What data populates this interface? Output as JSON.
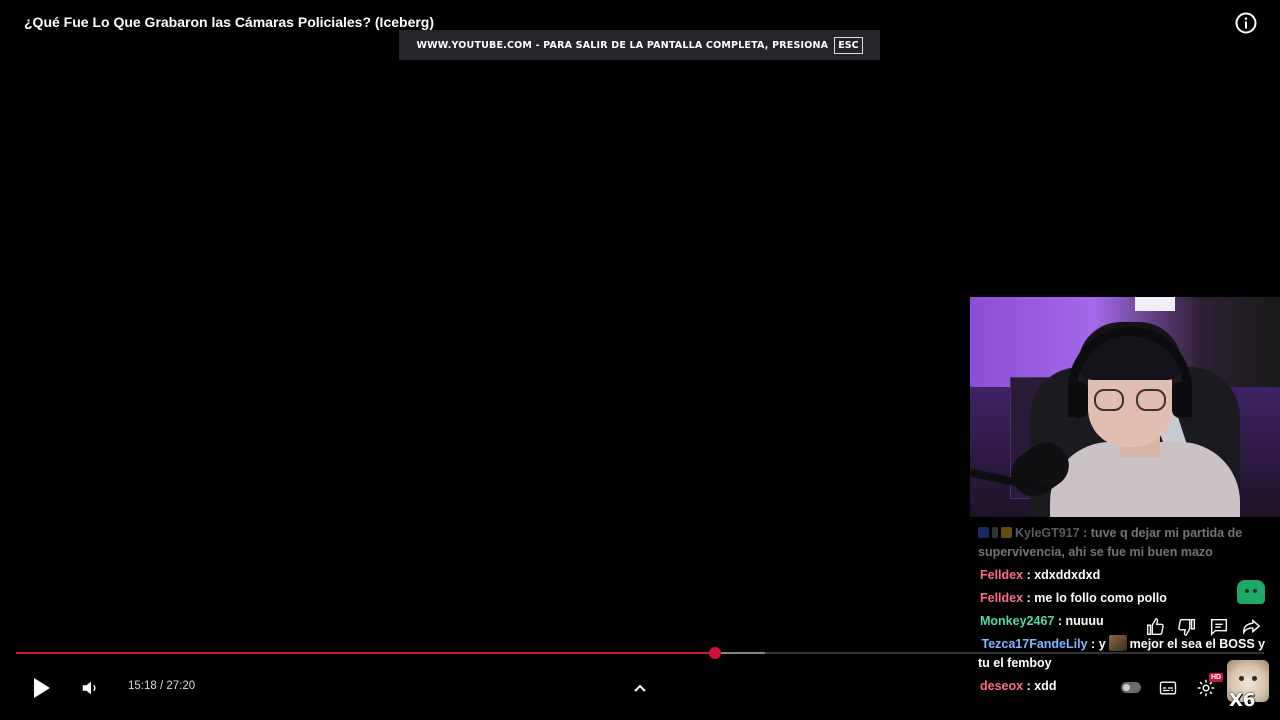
{
  "video": {
    "title": "¿Qué Fue Lo Que Grabaron las Cámaras Policiales? (Iceberg)"
  },
  "fullscreen_banner": {
    "message": "WWW.YOUTUBE.COM - PARA SALIR DE LA PANTALLA COMPLETA, PRESIONA",
    "key": "ESC"
  },
  "chat": {
    "messages": [
      {
        "user": "KyleGT917",
        "text": "tuve q dejar mi partida de supervivencia, ahi se fue mi buen mazo",
        "color": "#c9c9c9",
        "faded": true
      },
      {
        "user": "Felldex",
        "text": "xdxddxdxd",
        "color": "#ff6b8b"
      },
      {
        "user": "Felldex",
        "text": "me lo follo como pollo",
        "color": "#ff6b8b"
      },
      {
        "user": "Monkey2467",
        "text": "nuuuu",
        "color": "#56d6b0"
      },
      {
        "user": "Tezca17FandeLily",
        "text_before": "y",
        "text_after": "mejor el sea el BOSS y tu el femboy",
        "color": "#7fb6ff"
      },
      {
        "user": "deseox",
        "text": "xdd",
        "color": "#ff6b8b"
      }
    ],
    "separator": ":"
  },
  "player": {
    "current_time": "15:18",
    "duration": "27:20",
    "time_display": "15:18 / 27:20",
    "progress_fraction": 0.56,
    "buffered_fraction": 0.6,
    "accent_color": "#c4183c",
    "hd_badge": "HD"
  },
  "sticker": {
    "label": "X6"
  },
  "icons": {
    "info": "info-icon",
    "play": "play-icon",
    "volume": "volume-icon",
    "chevron": "chevron-up-icon",
    "like": "thumbs-up-icon",
    "dislike": "thumbs-down-icon",
    "comments": "comment-icon",
    "share": "share-icon",
    "subtitles": "subtitles-icon",
    "settings": "gear-icon"
  }
}
